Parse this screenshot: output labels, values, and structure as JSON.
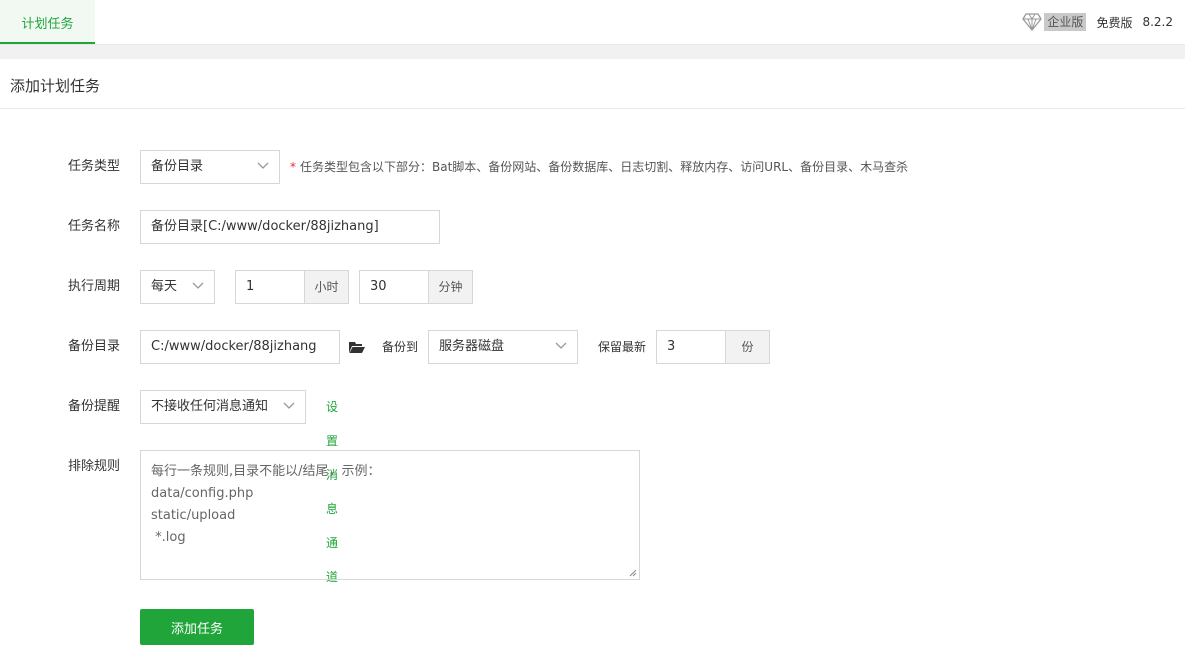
{
  "header": {
    "active_tab": "计划任务",
    "enterprise_label": "企业版",
    "free_label": "免费版",
    "version": "8.2.2"
  },
  "page": {
    "title": "添加计划任务"
  },
  "form": {
    "task_type": {
      "label": "任务类型",
      "value": "备份目录",
      "hint_star": "*",
      "hint": "任务类型包含以下部分：Bat脚本、备份网站、备份数据库、日志切割、释放内存、访问URL、备份目录、木马查杀"
    },
    "task_name": {
      "label": "任务名称",
      "value": "备份目录[C:/www/docker/88jizhang]"
    },
    "period": {
      "label": "执行周期",
      "cycle": "每天",
      "hour": "1",
      "hour_unit": "小时",
      "minute": "30",
      "minute_unit": "分钟"
    },
    "backup_dir": {
      "label": "备份目录",
      "path": "C:/www/docker/88jizhang",
      "backup_to_label": "备份到",
      "backup_to": "服务器磁盘",
      "keep_label": "保留最新",
      "keep_count": "3",
      "keep_unit": "份"
    },
    "notify": {
      "label": "备份提醒",
      "value": "不接收任何消息通知",
      "link": "设置消息通道"
    },
    "exclude": {
      "label": "排除规则",
      "lines": [
        "每行一条规则,目录不能以/结尾，示例：",
        "data/config.php",
        "static/upload",
        " *.log"
      ]
    },
    "submit_label": "添加任务"
  },
  "colors": {
    "accent": "#20a53a",
    "required": "#e52f2f"
  }
}
